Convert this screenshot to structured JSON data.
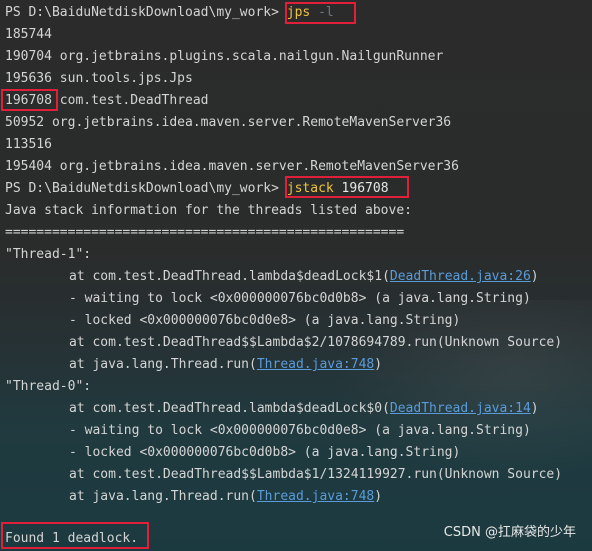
{
  "terminal": {
    "prompt1": "PS D:\\BaiduNetdiskDownload\\my_work> ",
    "cmd1": "jps",
    "cmd1_arg": " -l",
    "jps_lines": [
      "185744",
      "190704 org.jetbrains.plugins.scala.nailgun.NailgunRunner",
      "195636 sun.tools.jps.Jps"
    ],
    "deadthread_pid": "196708",
    "deadthread_class": " com.test.DeadThread",
    "jps_lines2": [
      "50952 org.jetbrains.idea.maven.server.RemoteMavenServer36",
      "113516",
      "195404 org.jetbrains.idea.maven.server.RemoteMavenServer36"
    ],
    "prompt2": "PS D:\\BaiduNetdiskDownload\\my_work> ",
    "cmd2": "jstack",
    "cmd2_arg": " 196708",
    "stack_header": "Java stack information for the threads listed above:",
    "separator": "===================================================",
    "thread1": {
      "name": "\"Thread-1\":",
      "l1_pre": "at com.test.DeadThread.lambda$deadLock$1(",
      "l1_link": "DeadThread.java:26",
      "l1_post": ")",
      "l2": "- waiting to lock <0x000000076bc0d0b8> (a java.lang.String)",
      "l3": "- locked <0x000000076bc0d0e8> (a java.lang.String)",
      "l4": "at com.test.DeadThread$$Lambda$2/1078694789.run(Unknown Source)",
      "l5_pre": "at java.lang.Thread.run(",
      "l5_link": "Thread.java:748",
      "l5_post": ")"
    },
    "thread0": {
      "name": "\"Thread-0\":",
      "l1_pre": "at com.test.DeadThread.lambda$deadLock$0(",
      "l1_link": "DeadThread.java:14",
      "l1_post": ")",
      "l2": "- waiting to lock <0x000000076bc0d0e8> (a java.lang.String)",
      "l3": "- locked <0x000000076bc0d0b8> (a java.lang.String)",
      "l4": "at com.test.DeadThread$$Lambda$1/1324119927.run(Unknown Source)",
      "l5_pre": "at java.lang.Thread.run(",
      "l5_link": "Thread.java:748",
      "l5_post": ")"
    },
    "found": "Found 1 deadlock."
  },
  "watermark": "CSDN @扛麻袋的少年",
  "colors": {
    "highlight_border": "#e0203a",
    "command": "#f0c23b",
    "link": "#5a9bd8",
    "text": "#d4d4d4"
  }
}
